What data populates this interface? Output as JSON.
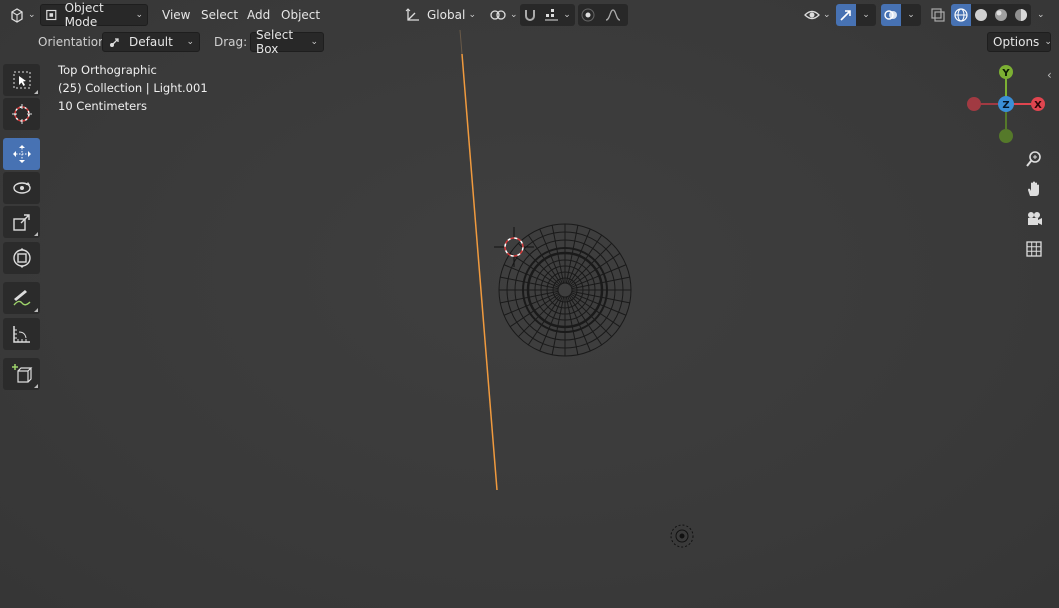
{
  "header": {
    "editor_type_icon": "view3d-icon",
    "mode": {
      "label": "Object Mode",
      "icon": "object-mode-icon"
    },
    "menus": [
      "View",
      "Select",
      "Add",
      "Object"
    ],
    "transform_orientation": {
      "label": "Global",
      "icon": "orientation-axes-icon"
    },
    "pivot_icon": "pivot-link-icon",
    "snap_icon": "snap-magnet-icon",
    "snap_target_icon": "snap-increment-icon",
    "proportional_icon": "proportional-dot-icon",
    "falloff_icon": "falloff-curve-icon",
    "visibility_icon": "eye-icon",
    "gizmo_icon": "gizmo-arrow-icon",
    "overlay_icon": "overlay-circles-icon",
    "xray_icon": "xray-icon",
    "shading_modes": [
      "wireframe",
      "solid",
      "material",
      "rendered"
    ],
    "active_shading": "wireframe"
  },
  "tool_settings": {
    "orientation_label": "Orientation:",
    "orientation_value": "Default",
    "drag_label": "Drag:",
    "drag_value": "Select Box",
    "options_label": "Options"
  },
  "toolbar": {
    "tools": [
      "select-box",
      "cursor",
      "move",
      "rotate",
      "scale",
      "transform",
      "annotate",
      "measure",
      "add-cube"
    ],
    "active_tool": "move"
  },
  "viewport_info": {
    "view_name": "Top Orthographic",
    "collection_line": "(25) Collection | Light.001",
    "scale_line": "10 Centimeters"
  },
  "gizmo": {
    "axis_y": "Y",
    "axis_z": "Z",
    "axis_x": "X",
    "colors": {
      "x": "#e0454f",
      "y": "#7cb033",
      "z": "#3b8fd6"
    }
  },
  "colors": {
    "accent": "#4772b3",
    "selection_orange": "#f09a3e",
    "background": "#3d3d3d"
  }
}
